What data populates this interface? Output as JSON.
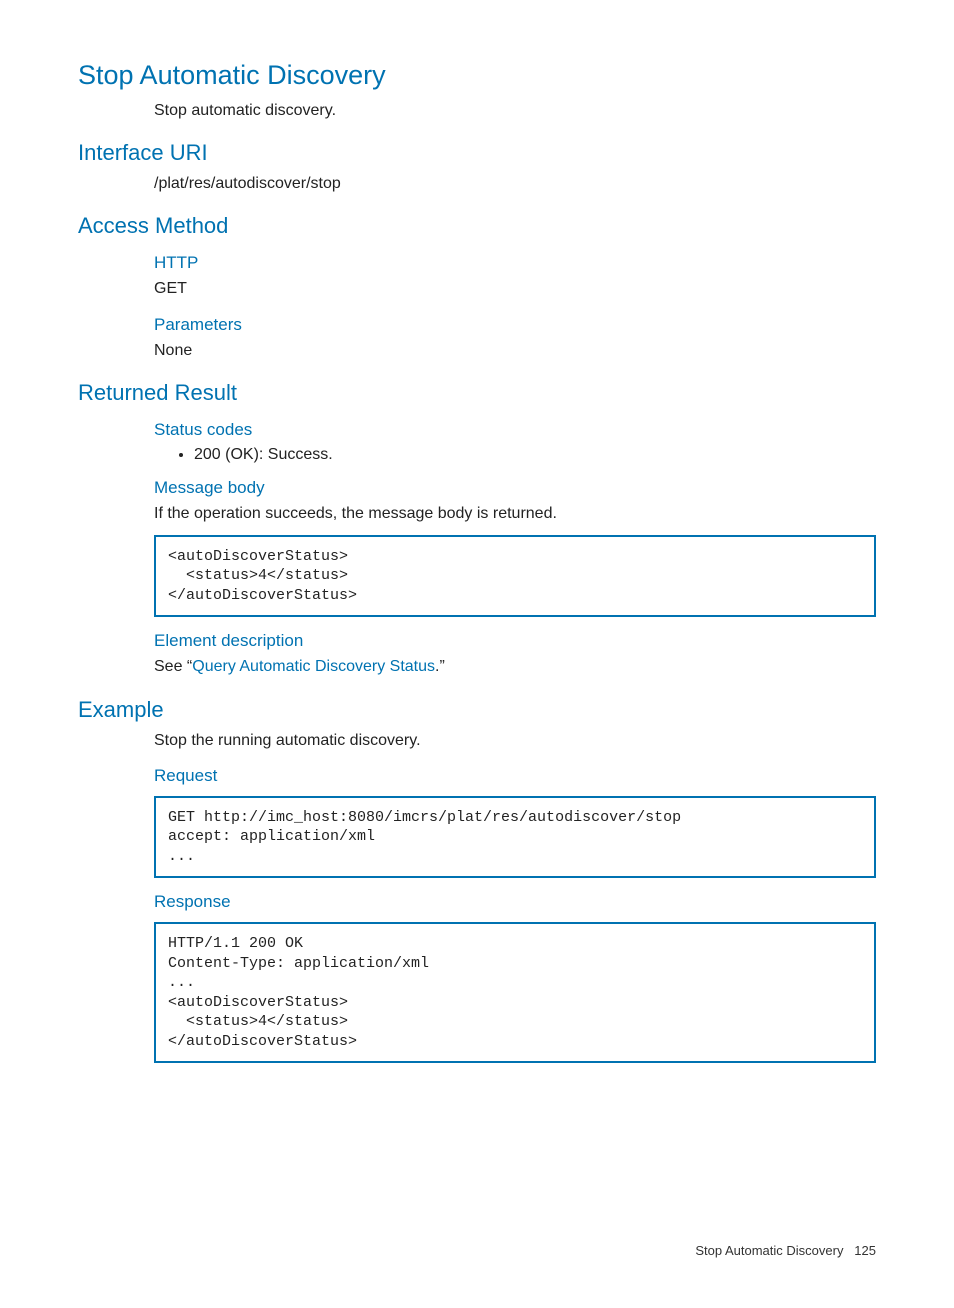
{
  "title": "Stop Automatic Discovery",
  "intro": "Stop automatic discovery.",
  "sections": {
    "interface_uri": {
      "heading": "Interface URI",
      "value": "/plat/res/autodiscover/stop"
    },
    "access_method": {
      "heading": "Access Method",
      "http_label": "HTTP",
      "http_value": "GET",
      "parameters_label": "Parameters",
      "parameters_value": "None"
    },
    "returned_result": {
      "heading": "Returned Result",
      "status_codes_label": "Status codes",
      "status_code_item": "200 (OK): Success.",
      "message_body_label": "Message body",
      "message_body_text": "If the operation succeeds, the message body is returned.",
      "message_body_code": "<autoDiscoverStatus>\n  <status>4</status>\n</autoDiscoverStatus>",
      "element_desc_label": "Element description",
      "element_desc_prefix": "See “",
      "element_desc_link": "Query Automatic Discovery Status",
      "element_desc_suffix": ".”"
    },
    "example": {
      "heading": "Example",
      "intro": "Stop the running automatic discovery.",
      "request_label": "Request",
      "request_code": "GET http://imc_host:8080/imcrs/plat/res/autodiscover/stop\naccept: application/xml\n...",
      "response_label": "Response",
      "response_code": "HTTP/1.1 200 OK\nContent-Type: application/xml\n...\n<autoDiscoverStatus>\n  <status>4</status>\n</autoDiscoverStatus>"
    }
  },
  "footer": {
    "title": "Stop Automatic Discovery",
    "page": "125"
  }
}
